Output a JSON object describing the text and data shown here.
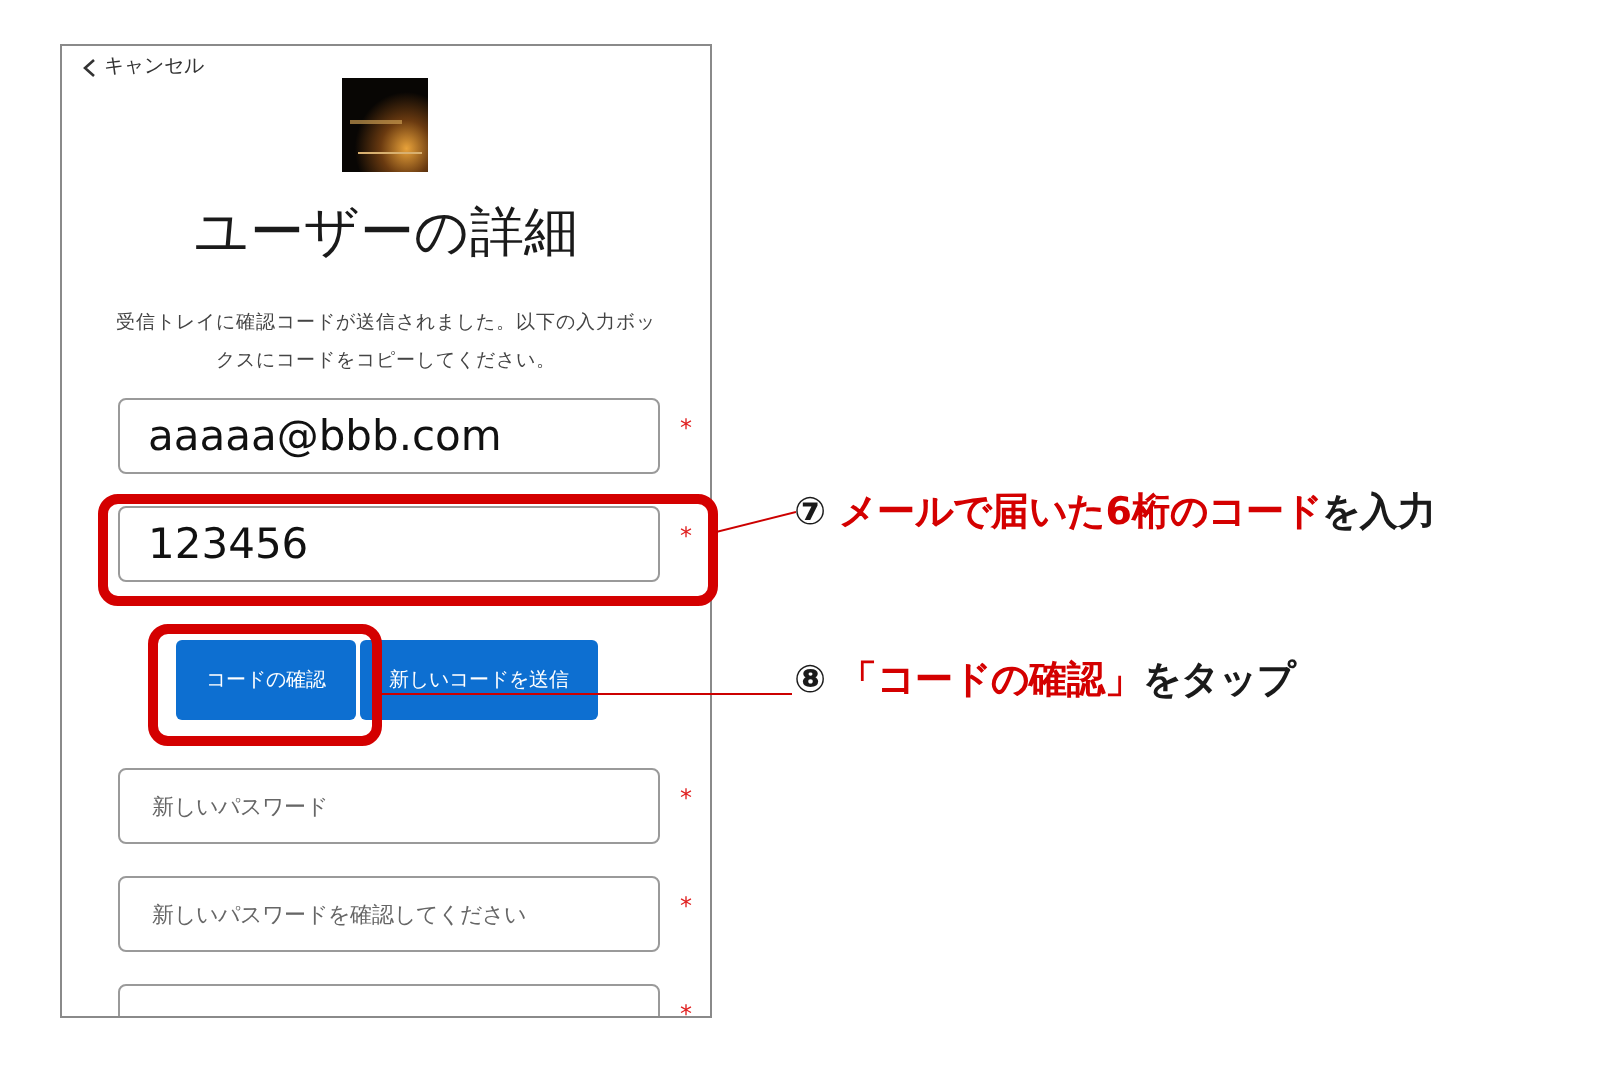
{
  "header": {
    "back_label": "キャンセル"
  },
  "title": "ユーザーの詳細",
  "message": "受信トレイに確認コードが送信されました。以下の入力ボックスにコードをコピーしてください。",
  "fields_top": [
    {
      "kind": "value",
      "text": "aaaaa@bbb.com",
      "required_mark": "*",
      "highlighted": false
    },
    {
      "kind": "value",
      "text": "123456",
      "required_mark": "*",
      "highlighted": true
    }
  ],
  "buttons": [
    {
      "label": "コードの確認",
      "highlighted": true
    },
    {
      "label": "新しいコードを送信",
      "highlighted": false
    }
  ],
  "fields_bottom": [
    {
      "kind": "placeholder",
      "placeholder": "新しいパスワード",
      "required_mark": "*"
    },
    {
      "kind": "placeholder",
      "placeholder": "新しいパスワードを確認してください",
      "required_mark": "*"
    },
    {
      "kind": "empty",
      "required_mark": "*"
    }
  ],
  "annotations": [
    {
      "number": "⑦",
      "parts": [
        {
          "text": "メールで届いた6桁のコード",
          "emphasis": true
        },
        {
          "text": "を入力",
          "emphasis": false
        }
      ]
    },
    {
      "number": "⑧",
      "parts": [
        {
          "text": "「コードの確認」",
          "emphasis": true
        },
        {
          "text": "をタップ",
          "emphasis": false
        }
      ]
    }
  ]
}
